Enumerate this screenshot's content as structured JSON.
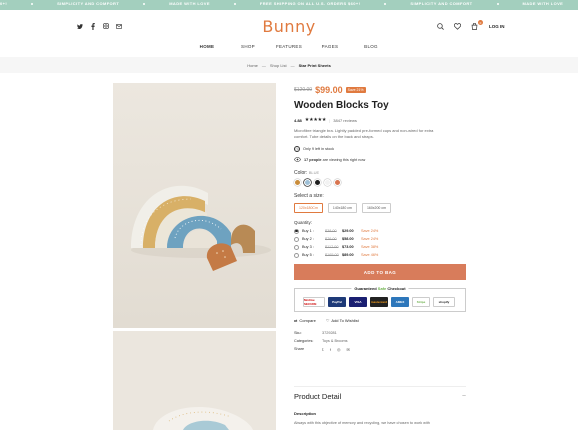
{
  "ticker": [
    "D U.S. ORDERS $60+!",
    "SIMPLICITY AND COMFORT",
    "MADE WITH LOVE",
    "FREE SHIPPING ON ALL U.S. ORDERS $60+!",
    "SIMPLICITY AND COMFORT",
    "MADE WITH LOVE",
    "FREE SHIPPING ON ALL"
  ],
  "header": {
    "logo": "Bunny",
    "login": "LOG IN",
    "cart_count": "0",
    "social_icons": [
      "twitter-icon",
      "facebook-icon",
      "instagram-icon",
      "email-icon"
    ]
  },
  "nav": [
    "HOME",
    "SHOP",
    "FEATURES",
    "PAGES",
    "BLOG"
  ],
  "breadcrumb": {
    "home": "Home",
    "sep": "—",
    "shop": "Shop List",
    "current": "Star Print Sheets"
  },
  "product": {
    "price_old": "$120.00",
    "price_new": "$99.00",
    "save": "Save 21%",
    "title": "Wooden Blocks Toy",
    "rating": "4.88",
    "stars": "★★★★★",
    "reviews": "3847 reviews",
    "description": "Microfibre triangle bra. Lightly padded pre-formed cups and non-wired for extra comfort. Tube details on the back and straps.",
    "stock_note": "Only 9 left in stock",
    "viewers_count": "17 people",
    "viewers_text": "are viewing this right now",
    "color_label": "Color:",
    "color_value": "BLUE",
    "colors": [
      "#c98c3a",
      "#9dbfd6",
      "#1d1d1d",
      "#f2f2f2",
      "#d8744f"
    ],
    "size_label": "Select a size:",
    "sizes": [
      "120x180Cm",
      "140x180 cm",
      "160x200 cm"
    ],
    "quantity_label": "Quantity:",
    "bundles": [
      {
        "label": "Buy 1 :",
        "old": "$38.00",
        "new": "$29.00",
        "save": "Save 24%"
      },
      {
        "label": "Buy 2 :",
        "old": "$76.00",
        "new": "$58.00",
        "save": "Save 24%"
      },
      {
        "label": "Buy 3 :",
        "old": "$117.00",
        "new": "$73.00",
        "save": "Save 38%"
      },
      {
        "label": "Buy 5 :",
        "old": "$165.00",
        "new": "$89.00",
        "save": "Save 46%"
      }
    ],
    "add_to_bag": "ADD TO BAG",
    "checkout_title_pre": "Guaranteed ",
    "checkout_title_safe": "Safe",
    "checkout_title_post": " Checkout",
    "compare": "Compare",
    "wishlist": "Add To Wishlist",
    "sku_label": "Sku:",
    "sku": "3729281",
    "categories_label": "Categories:",
    "categories": "Toys & Brooms",
    "share_label": "Share",
    "detail_title": "Product Detail",
    "detail_toggle": "−",
    "description_label": "Description",
    "description_text": "Always with this objective of memory and recycling, we have chosen to work with"
  },
  "payment_badges": [
    "McAfee SECURE",
    "PayPal",
    "VISA",
    "mastercard",
    "AMEX",
    "Stripe",
    "shopify"
  ]
}
